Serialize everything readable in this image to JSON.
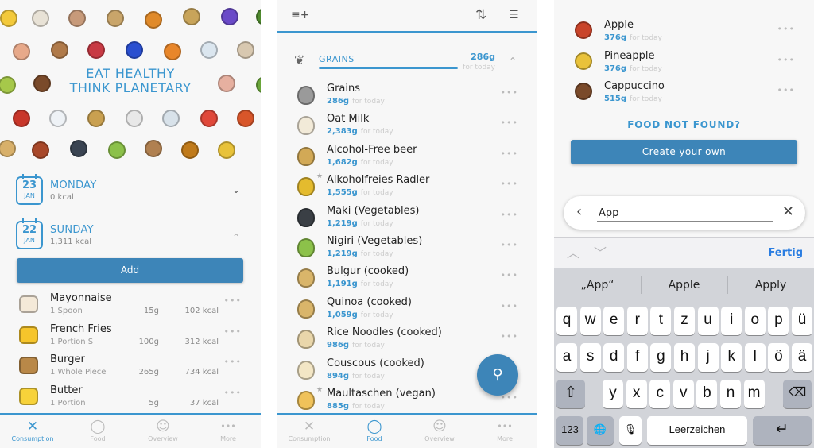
{
  "colors": {
    "accent": "#3b96cf",
    "button": "#3d85b8",
    "ios_blue": "#2a7de1"
  },
  "panel1": {
    "hero": {
      "title_line1": "EAT HEALTHY",
      "title_line2": "THINK PLANETARY"
    },
    "days": [
      {
        "day_num": "23",
        "month": "JAN",
        "name": "MONDAY",
        "kcal": "0 kcal",
        "expanded": false,
        "chevron": "⌄"
      },
      {
        "day_num": "22",
        "month": "JAN",
        "name": "SUNDAY",
        "kcal": "1,311 kcal",
        "expanded": true,
        "chevron": "⌃"
      }
    ],
    "add_label": "Add",
    "entries": [
      {
        "icon": "mayonnaise-icon",
        "name": "Mayonnaise",
        "portion": "1 Spoon",
        "grams": "15g",
        "kcal": "102 kcal",
        "color": "#f4e9d8"
      },
      {
        "icon": "french-fries-icon",
        "name": "French Fries",
        "portion": "1 Portion S",
        "grams": "100g",
        "kcal": "312 kcal",
        "color": "#f6c52b"
      },
      {
        "icon": "burger-icon",
        "name": "Burger",
        "portion": "1 Whole Piece",
        "grams": "265g",
        "kcal": "734 kcal",
        "color": "#b98848"
      },
      {
        "icon": "butter-icon",
        "name": "Butter",
        "portion": "1 Portion",
        "grams": "5g",
        "kcal": "37 kcal",
        "color": "#f7d23a"
      }
    ],
    "more_glyph": "•••",
    "tabs": [
      {
        "label": "Consumption",
        "icon": "cutlery-icon",
        "glyph": "✕",
        "active": true
      },
      {
        "label": "Food",
        "icon": "apple-icon",
        "glyph": "◯",
        "active": false
      },
      {
        "label": "Overview",
        "icon": "smiley-icon",
        "glyph": "☺",
        "active": false
      },
      {
        "label": "More",
        "icon": "more-icon",
        "glyph": "•••",
        "active": false
      }
    ]
  },
  "panel2": {
    "toolbar": {
      "add_list_glyph": "≡+",
      "sort_glyph": "⇅",
      "filter_glyph": "☰"
    },
    "category": {
      "label": "GRAINS",
      "amount": "286g",
      "sub": "for today",
      "progress": 1.0,
      "chevron": "⌃"
    },
    "items": [
      {
        "icon": "grains-icon",
        "name": "Grains",
        "amount": "286g",
        "sub": "for today",
        "starred": false,
        "color": "#9a9a9a"
      },
      {
        "icon": "oat-milk-icon",
        "name": "Oat Milk",
        "amount": "2,383g",
        "sub": "for today",
        "starred": false,
        "color": "#f2ead8"
      },
      {
        "icon": "beer-icon",
        "name": "Alcohol-Free beer",
        "amount": "1,682g",
        "sub": "for today",
        "starred": false,
        "color": "#d2a956"
      },
      {
        "icon": "radler-icon",
        "name": "Alkoholfreies Radler",
        "amount": "1,555g",
        "sub": "for today",
        "starred": true,
        "color": "#e4bb2e"
      },
      {
        "icon": "maki-icon",
        "name": "Maki (Vegetables)",
        "amount": "1,219g",
        "sub": "for today",
        "starred": false,
        "color": "#3a3f45"
      },
      {
        "icon": "nigiri-icon",
        "name": "Nigiri (Vegetables)",
        "amount": "1,219g",
        "sub": "for today",
        "starred": false,
        "color": "#8cc14a"
      },
      {
        "icon": "bulgur-icon",
        "name": "Bulgur (cooked)",
        "amount": "1,191g",
        "sub": "for today",
        "starred": false,
        "color": "#d9b56a"
      },
      {
        "icon": "quinoa-icon",
        "name": "Quinoa (cooked)",
        "amount": "1,059g",
        "sub": "for today",
        "starred": false,
        "color": "#d9b56a"
      },
      {
        "icon": "rice-noodles-icon",
        "name": "Rice Noodles (cooked)",
        "amount": "986g",
        "sub": "for today",
        "starred": false,
        "color": "#e9d6aa"
      },
      {
        "icon": "couscous-icon",
        "name": "Couscous (cooked)",
        "amount": "894g",
        "sub": "for today",
        "starred": false,
        "color": "#f3e6c5"
      },
      {
        "icon": "maultaschen-icon",
        "name": "Maultaschen (vegan)",
        "amount": "885g",
        "sub": "for today",
        "starred": true,
        "color": "#f0c25a"
      }
    ],
    "more_glyph": "•••",
    "search_glyph": "⚲",
    "tabs": [
      {
        "label": "Consumption",
        "icon": "cutlery-icon",
        "glyph": "✕",
        "active": false
      },
      {
        "label": "Food",
        "icon": "apple-icon",
        "glyph": "◯",
        "active": true
      },
      {
        "label": "Overview",
        "icon": "smiley-icon",
        "glyph": "☺",
        "active": false
      },
      {
        "label": "More",
        "icon": "more-icon",
        "glyph": "•••",
        "active": false
      }
    ]
  },
  "panel3": {
    "results": [
      {
        "icon": "apple-icon",
        "name": "Apple",
        "amount": "376g",
        "sub": "for today",
        "color": "#c9442a"
      },
      {
        "icon": "pineapple-icon",
        "name": "Pineapple",
        "amount": "376g",
        "sub": "for today",
        "color": "#e9c23a"
      },
      {
        "icon": "cappuccino-icon",
        "name": "Cappuccino",
        "amount": "515g",
        "sub": "for today",
        "color": "#7a4a2a"
      }
    ],
    "more_glyph": "•••",
    "not_found": "FOOD NOT FOUND?",
    "create_label": "Create your own",
    "search": {
      "back_glyph": "‹",
      "value": "App",
      "clear_glyph": "✕"
    },
    "keyboard": {
      "up_glyph": "︿",
      "down_glyph": "﹀",
      "done_label": "Fertig",
      "suggestions": [
        "„App“",
        "Apple",
        "Apply"
      ],
      "row1": [
        "q",
        "w",
        "e",
        "r",
        "t",
        "z",
        "u",
        "i",
        "o",
        "p",
        "ü"
      ],
      "row2": [
        "a",
        "s",
        "d",
        "f",
        "g",
        "h",
        "j",
        "k",
        "l",
        "ö",
        "ä"
      ],
      "row3": [
        "y",
        "x",
        "c",
        "v",
        "b",
        "n",
        "m"
      ],
      "shift_glyph": "⇧",
      "delete_glyph": "⌫",
      "numbers_label": "123",
      "globe_glyph": "🌐",
      "mic_glyph": "🎙",
      "space_label": "Leerzeichen",
      "return_glyph": "↵"
    }
  }
}
